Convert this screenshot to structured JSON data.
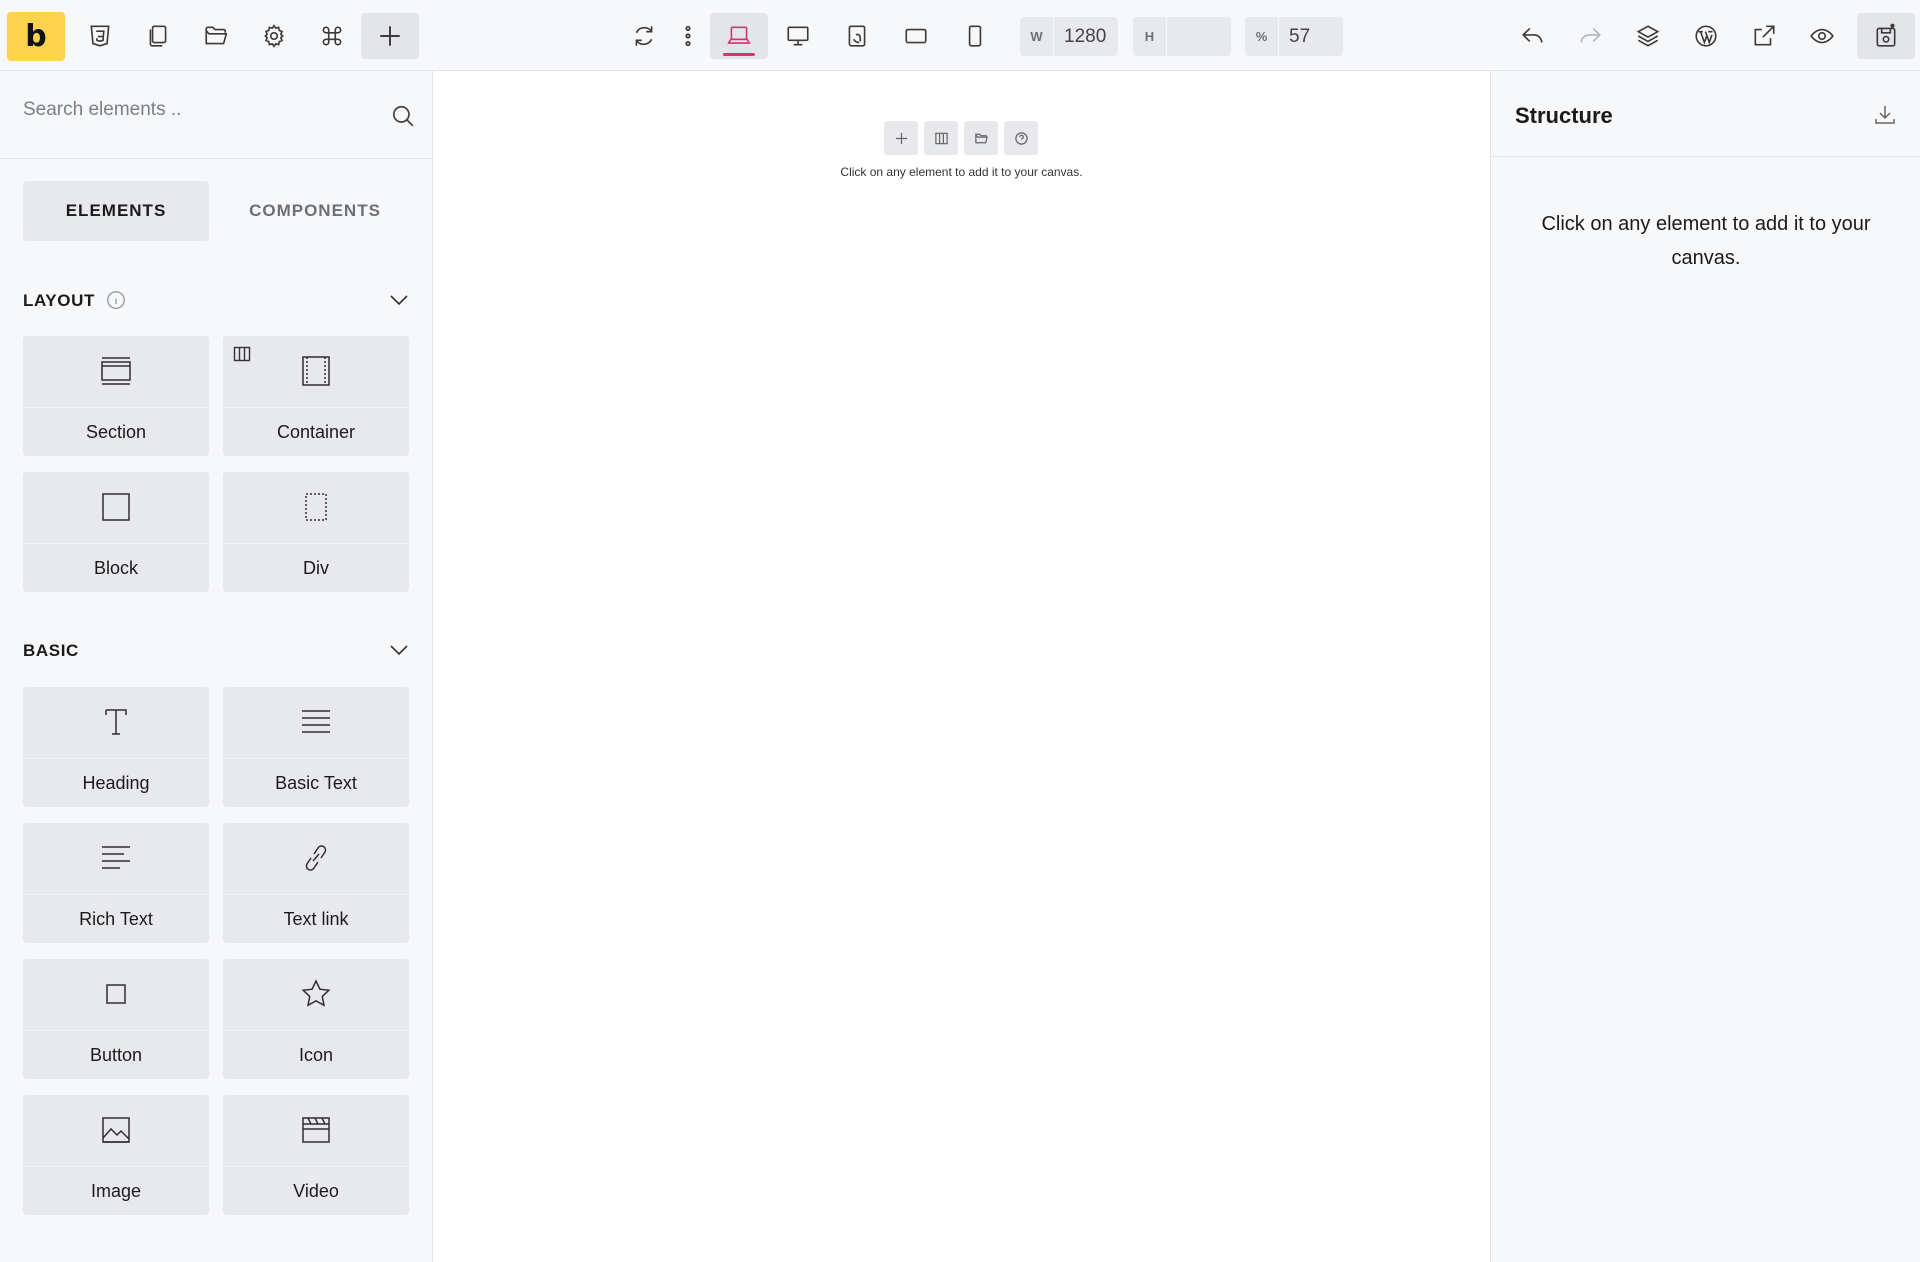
{
  "app": {
    "logo_letter": "b"
  },
  "toolbar": {
    "left_icons": [
      "html5-icon",
      "pages-icon",
      "folder-icon",
      "gear-icon",
      "command-icon",
      "plus-icon"
    ],
    "center_icons": [
      "refresh-icon",
      "more-vertical-icon",
      "laptop-icon",
      "desktop-icon",
      "tablet-landscape-icon",
      "tablet-portrait-icon",
      "mobile-icon"
    ],
    "active_device": "laptop",
    "width_label": "W",
    "width_value": "1280",
    "height_label": "H",
    "height_value": "",
    "zoom_label": "%",
    "zoom_value": "57",
    "right_icons": [
      "undo-icon",
      "redo-icon",
      "layers-icon",
      "wordpress-icon",
      "external-link-icon",
      "eye-icon",
      "save-icon"
    ],
    "accent_color": "#d5356f",
    "logo_color": "#fcd34d"
  },
  "left_panel": {
    "search_placeholder": "Search elements ..",
    "tabs": [
      {
        "label": "ELEMENTS",
        "active": true
      },
      {
        "label": "COMPONENTS",
        "active": false
      }
    ],
    "groups": [
      {
        "title": "LAYOUT",
        "items": [
          {
            "label": "Section",
            "icon": "section-icon"
          },
          {
            "label": "Container",
            "icon": "container-icon"
          },
          {
            "label": "Block",
            "icon": "block-icon"
          },
          {
            "label": "Div",
            "icon": "div-icon"
          }
        ]
      },
      {
        "title": "BASIC",
        "items": [
          {
            "label": "Heading",
            "icon": "heading-icon"
          },
          {
            "label": "Basic Text",
            "icon": "basic-text-icon"
          },
          {
            "label": "Rich Text",
            "icon": "rich-text-icon"
          },
          {
            "label": "Text link",
            "icon": "link-icon"
          },
          {
            "label": "Button",
            "icon": "button-icon"
          },
          {
            "label": "Icon",
            "icon": "star-icon"
          },
          {
            "label": "Image",
            "icon": "image-icon"
          },
          {
            "label": "Video",
            "icon": "video-icon"
          }
        ]
      }
    ]
  },
  "canvas": {
    "tools": [
      "plus-icon",
      "columns-icon",
      "folder-icon",
      "help-icon"
    ],
    "message": "Click on any element to add it to your canvas."
  },
  "right_panel": {
    "title": "Structure",
    "message": "Click on any element to add it to your canvas."
  }
}
